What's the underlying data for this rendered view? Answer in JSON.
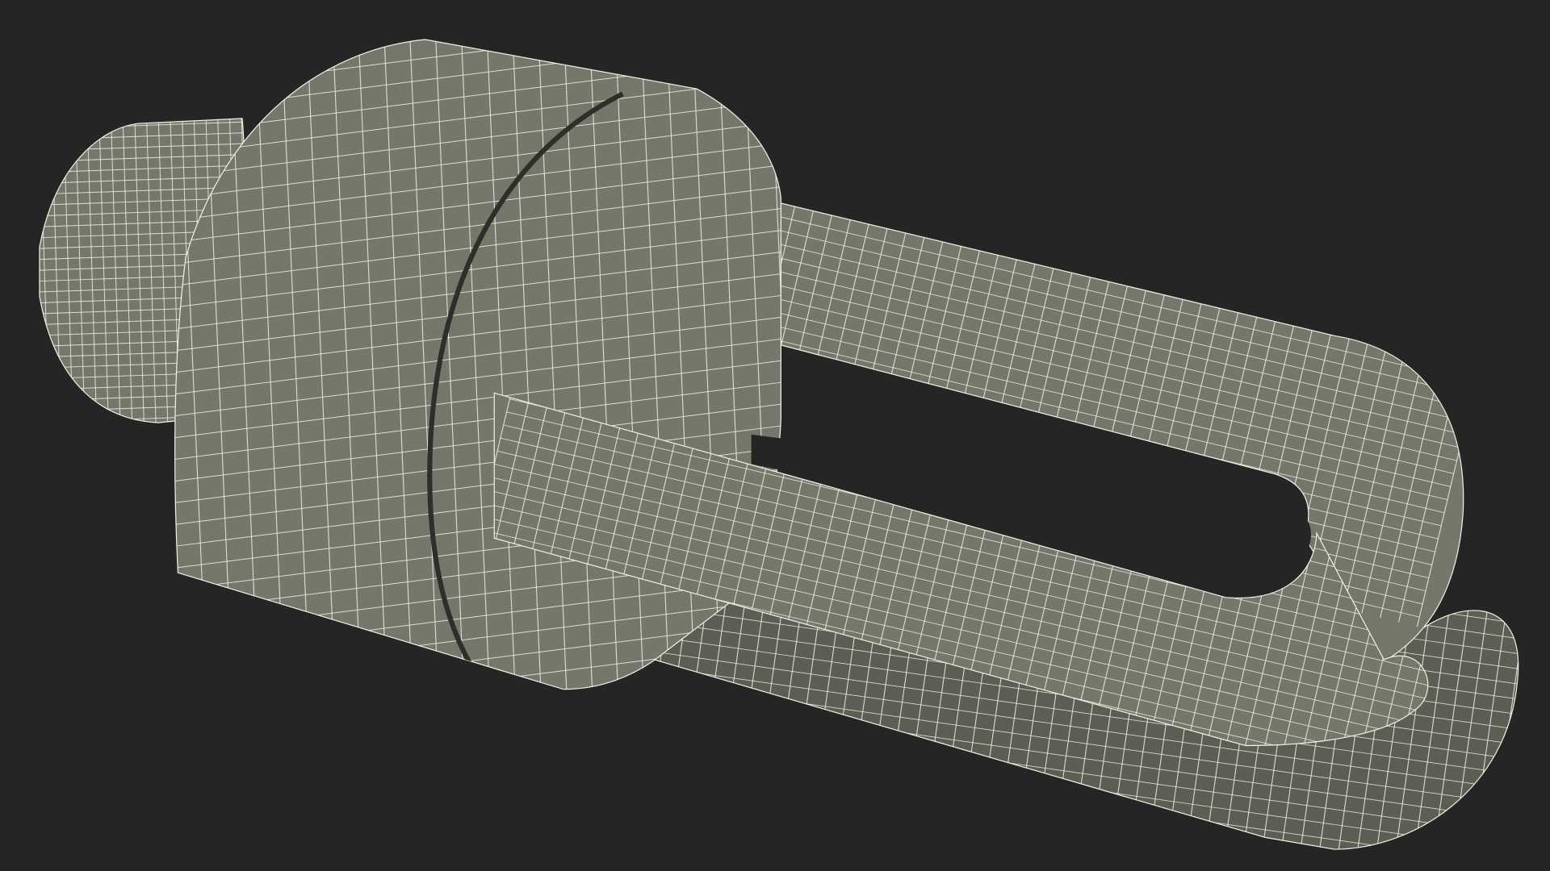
{
  "scene": {
    "subject": "wireframe-cfl-bulb-model",
    "colors": {
      "background": "#252525",
      "surface": "#76766b",
      "surface_dark": "#5d5d54",
      "surface_shadow": "#4a4a43",
      "wire": "#f1f0e6",
      "gap": "#2e2e2b"
    }
  }
}
